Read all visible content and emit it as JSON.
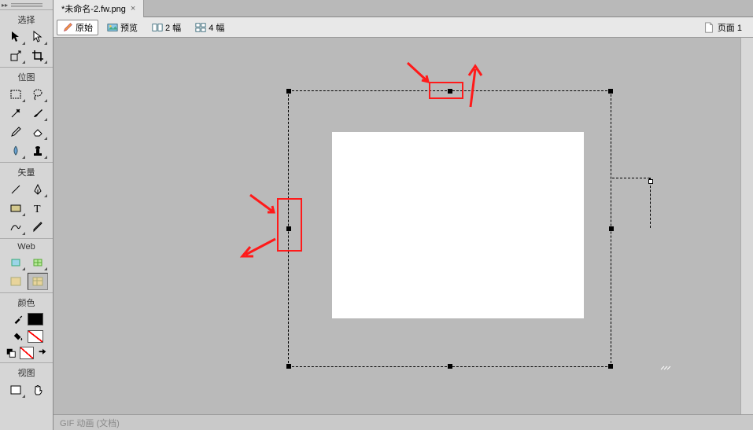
{
  "tab": {
    "title": "*未命名-2.fw.png",
    "close": "×"
  },
  "viewBar": {
    "original": "原始",
    "preview": "预览",
    "two_up": "2 幅",
    "four_up": "4 幅",
    "page_label": "页面 1"
  },
  "toolbar": {
    "sections": {
      "select": "选择",
      "bitmap": "位图",
      "vector": "矢量",
      "web": "Web",
      "color": "颜色",
      "view": "视图"
    }
  },
  "colors": {
    "stroke": "#000000",
    "fill": "none",
    "bg": "#ffffff"
  },
  "status": {
    "text": "GIF 动画 (文档)"
  },
  "expand": "▸▸"
}
